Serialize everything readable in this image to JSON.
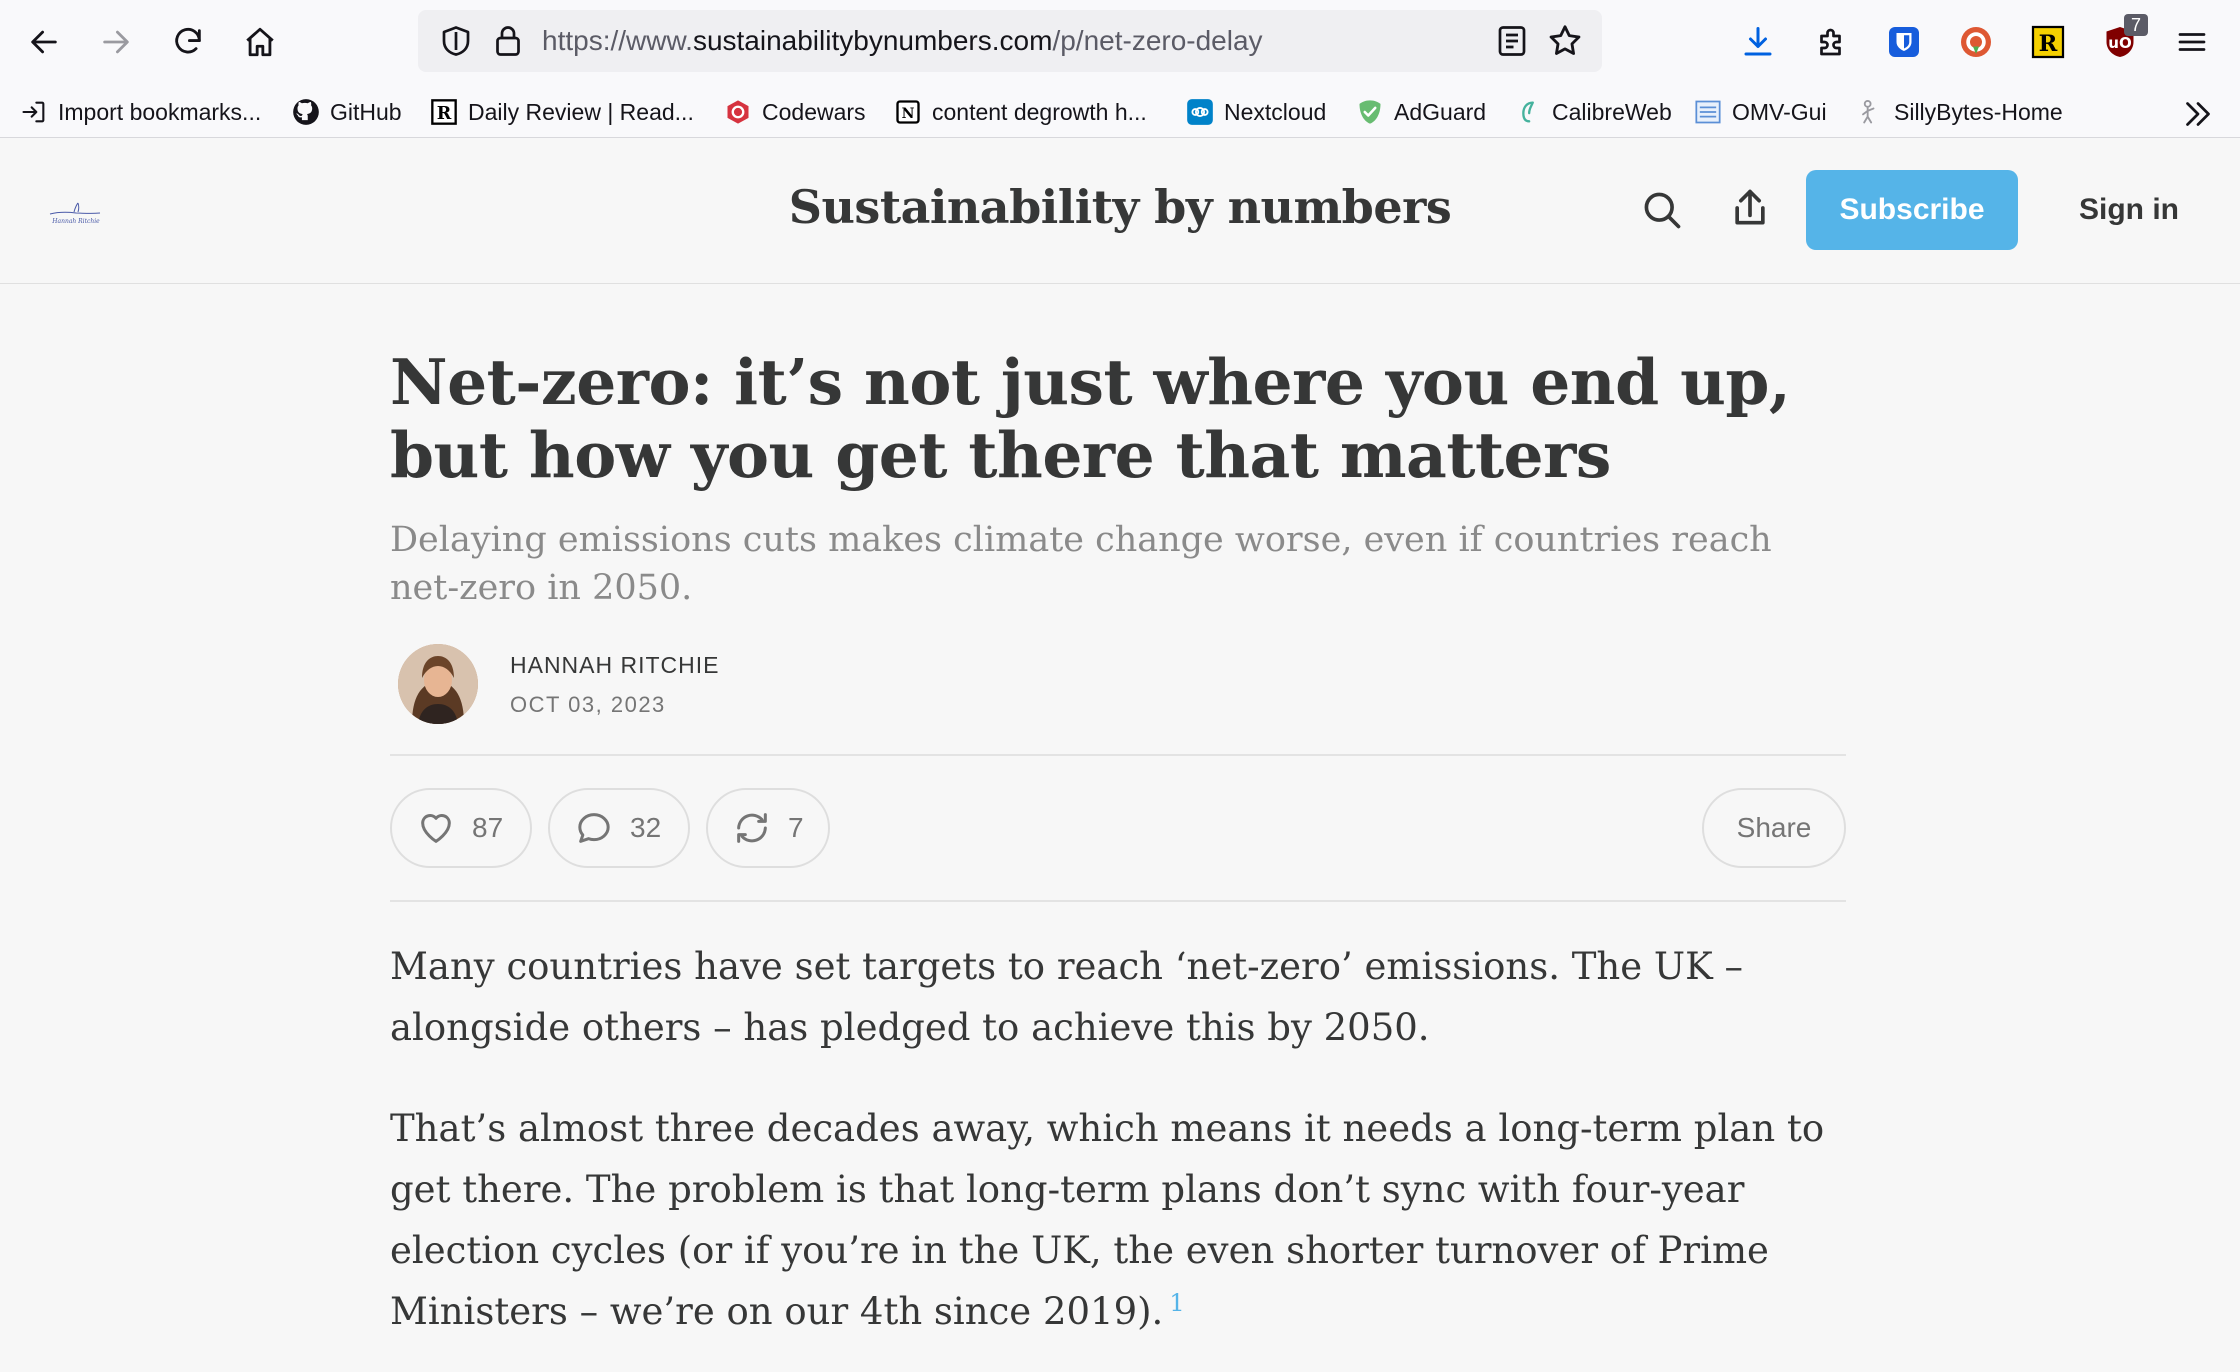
{
  "browser": {
    "url_prefix": "https://www.",
    "url_domain": "sustainabilitybynumbers.com",
    "url_path": "/p/net-zero-delay",
    "extension_badge": "7"
  },
  "bookmarks": [
    {
      "label": "Import bookmarks...",
      "icon": "import-icon"
    },
    {
      "label": "GitHub",
      "icon": "github-icon"
    },
    {
      "label": "Daily Review | Read...",
      "icon": "readwise-icon"
    },
    {
      "label": "Codewars",
      "icon": "codewars-icon"
    },
    {
      "label": "content degrowth h...",
      "icon": "notion-icon"
    },
    {
      "label": "Nextcloud",
      "icon": "nextcloud-icon"
    },
    {
      "label": "AdGuard",
      "icon": "adguard-icon"
    },
    {
      "label": "CalibreWeb",
      "icon": "calibre-icon"
    },
    {
      "label": "OMV-Gui",
      "icon": "omv-icon"
    },
    {
      "label": "SillyBytes-Home",
      "icon": "sillybytes-icon"
    }
  ],
  "site": {
    "title": "Sustainability by numbers",
    "subscribe_label": "Subscribe",
    "signin_label": "Sign in",
    "logo_text": "Hannah Ritchie"
  },
  "post": {
    "title": "Net-zero: it’s not just where you end up, but how you get there that matters",
    "subtitle": "Delaying emissions cuts makes climate change worse, even if countries reach net-zero in 2050.",
    "author": "HANNAH RITCHIE",
    "date": "OCT 03, 2023",
    "likes": "87",
    "comments": "32",
    "restacks": "7",
    "share_label": "Share",
    "paragraph1": "Many countries have set targets to reach ‘net-zero’ emissions. The UK – alongside others – has pledged to achieve this by 2050.",
    "paragraph2": "That’s almost three decades away, which means it needs a long-term plan to get there. The problem is that long-term plans don’t sync with four-year election cycles (or if you’re in the UK, the even shorter turnover of Prime Ministers – we’re on our 4th since 2019).",
    "footnote": "1"
  },
  "colors": {
    "accent": "#55b4e8",
    "text": "#363737",
    "muted": "#8a8a8a"
  }
}
